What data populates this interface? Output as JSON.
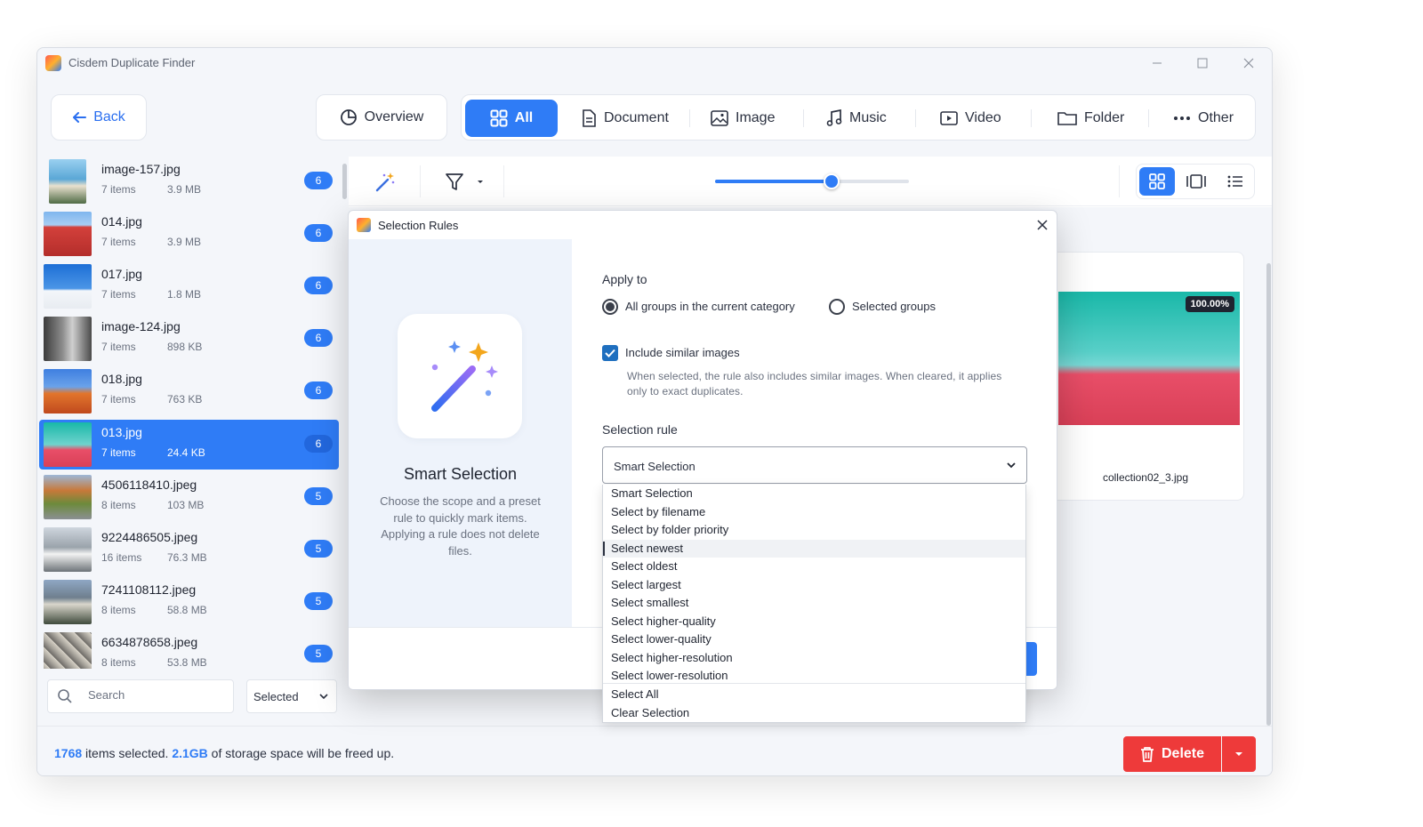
{
  "window": {
    "title": "Cisdem Duplicate Finder"
  },
  "nav": {
    "back": "Back",
    "overview": "Overview",
    "tabs": [
      {
        "label": "All",
        "icon": "grid-icon",
        "active": true
      },
      {
        "label": "Document",
        "icon": "document-icon"
      },
      {
        "label": "Image",
        "icon": "image-icon"
      },
      {
        "label": "Music",
        "icon": "music-icon"
      },
      {
        "label": "Video",
        "icon": "video-icon"
      },
      {
        "label": "Folder",
        "icon": "folder-icon"
      },
      {
        "label": "Other",
        "icon": "more-icon"
      }
    ]
  },
  "files": [
    {
      "name": "image-157.jpg",
      "items": "7 items",
      "size": "3.9 MB",
      "count": "6"
    },
    {
      "name": "014.jpg",
      "items": "7 items",
      "size": "3.9 MB",
      "count": "6"
    },
    {
      "name": "017.jpg",
      "items": "7 items",
      "size": "1.8 MB",
      "count": "6"
    },
    {
      "name": "image-124.jpg",
      "items": "7 items",
      "size": "898 KB",
      "count": "6"
    },
    {
      "name": "018.jpg",
      "items": "7 items",
      "size": "763 KB",
      "count": "6"
    },
    {
      "name": "013.jpg",
      "items": "7 items",
      "size": "24.4 KB",
      "count": "6",
      "selected": true
    },
    {
      "name": "4506118410.jpeg",
      "items": "8 items",
      "size": "103 MB",
      "count": "5"
    },
    {
      "name": "9224486505.jpeg",
      "items": "16 items",
      "size": "76.3 MB",
      "count": "5"
    },
    {
      "name": "7241108112.jpeg",
      "items": "8 items",
      "size": "58.8 MB",
      "count": "5"
    },
    {
      "name": "6634878658.jpeg",
      "items": "8 items",
      "size": "53.8 MB",
      "count": "5"
    }
  ],
  "search": {
    "placeholder": "Search"
  },
  "filter": {
    "value": "Selected"
  },
  "toolbar": {
    "thumb_size_percent": 60
  },
  "preview": {
    "badge": "100.00%",
    "filename": "collection02_3.jpg"
  },
  "status": {
    "count": "1768",
    "text1": "items selected.",
    "size": "2.1GB",
    "text2": "of storage space will be freed up."
  },
  "delete": {
    "label": "Delete"
  },
  "dialog": {
    "title": "Selection Rules",
    "left_title": "Smart Selection",
    "left_desc": "Choose the scope and a preset rule to quickly mark items. Applying a rule does not delete files.",
    "apply_to": "Apply to",
    "radio_all": "All groups in the current category",
    "radio_selected": "Selected groups",
    "include_similar": "Include similar images",
    "include_desc": "When selected, the rule also includes similar images. When cleared, it applies only to exact duplicates.",
    "selection_rule": "Selection rule",
    "rule_value": "Smart Selection",
    "options": [
      "Smart Selection",
      "Select by filename",
      "Select by folder priority",
      "Select newest",
      "Select oldest",
      "Select largest",
      "Select smallest",
      "Select higher-quality",
      "Select lower-quality",
      "Select higher-resolution",
      "Select lower-resolution",
      "Select All",
      "Clear Selection"
    ]
  }
}
